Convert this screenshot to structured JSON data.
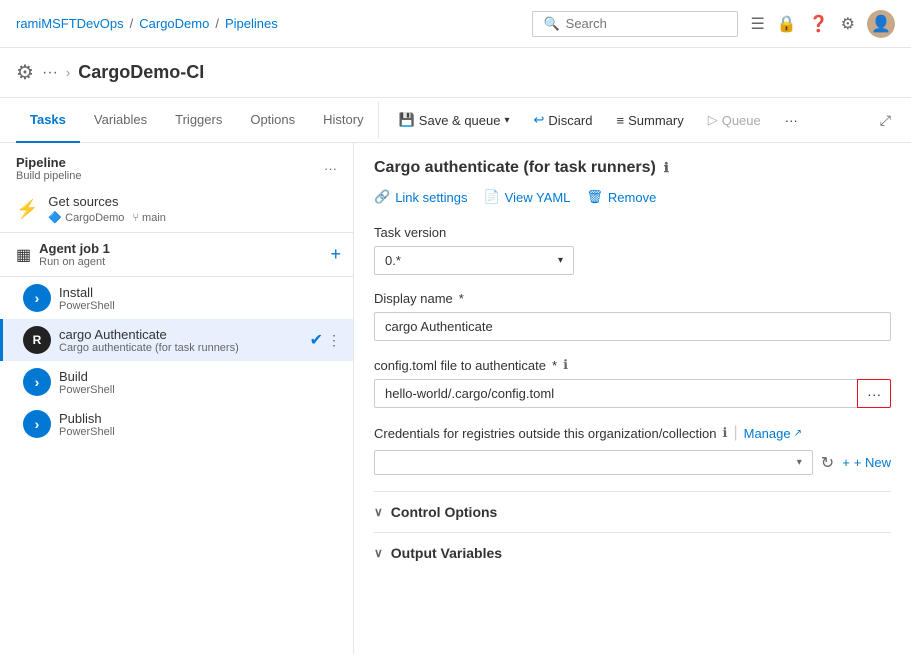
{
  "topnav": {
    "breadcrumb": [
      "ramiMSFTDevOps",
      "CargoDemo",
      "Pipelines"
    ],
    "search_placeholder": "Search"
  },
  "page": {
    "icon": "⚙",
    "dots": "···",
    "chevron": "›",
    "title": "CargoDemo-CI"
  },
  "tabs": {
    "items": [
      "Tasks",
      "Variables",
      "Triggers",
      "Options",
      "History"
    ],
    "active": "Tasks"
  },
  "toolbar": {
    "save_queue_label": "Save & queue",
    "discard_label": "Discard",
    "summary_label": "Summary",
    "queue_label": "Queue",
    "more_label": "···"
  },
  "sidebar": {
    "pipeline_title": "Pipeline",
    "pipeline_sub": "Build pipeline",
    "get_sources_label": "Get sources",
    "get_sources_repo": "CargoDemo",
    "get_sources_branch": "main",
    "agent_job_label": "Agent job 1",
    "agent_job_sub": "Run on agent",
    "tasks": [
      {
        "name": "Install",
        "sub": "PowerShell",
        "icon_type": "blue",
        "icon_char": "›"
      },
      {
        "name": "cargo Authenticate",
        "sub": "Cargo authenticate (for task runners)",
        "icon_type": "dark",
        "icon_char": "R",
        "active": true
      },
      {
        "name": "Build",
        "sub": "PowerShell",
        "icon_type": "blue",
        "icon_char": "›"
      },
      {
        "name": "Publish",
        "sub": "PowerShell",
        "icon_type": "blue",
        "icon_char": "›"
      }
    ]
  },
  "content": {
    "title": "Cargo authenticate (for task runners)",
    "actions": [
      {
        "label": "Link settings",
        "icon": "🔗"
      },
      {
        "label": "View YAML",
        "icon": "📄"
      },
      {
        "label": "Remove",
        "icon": "🗑"
      }
    ],
    "task_version_label": "Task version",
    "task_version_value": "0.*",
    "display_name_label": "Display name",
    "display_name_required": true,
    "display_name_value": "cargo Authenticate",
    "config_toml_label": "config.toml file to authenticate",
    "config_toml_required": true,
    "config_toml_value": "hello-world/.cargo/config.toml",
    "credentials_label": "Credentials for registries outside this organization/collection",
    "manage_label": "Manage",
    "new_label": "+ New",
    "control_options_label": "Control Options",
    "output_variables_label": "Output Variables"
  }
}
